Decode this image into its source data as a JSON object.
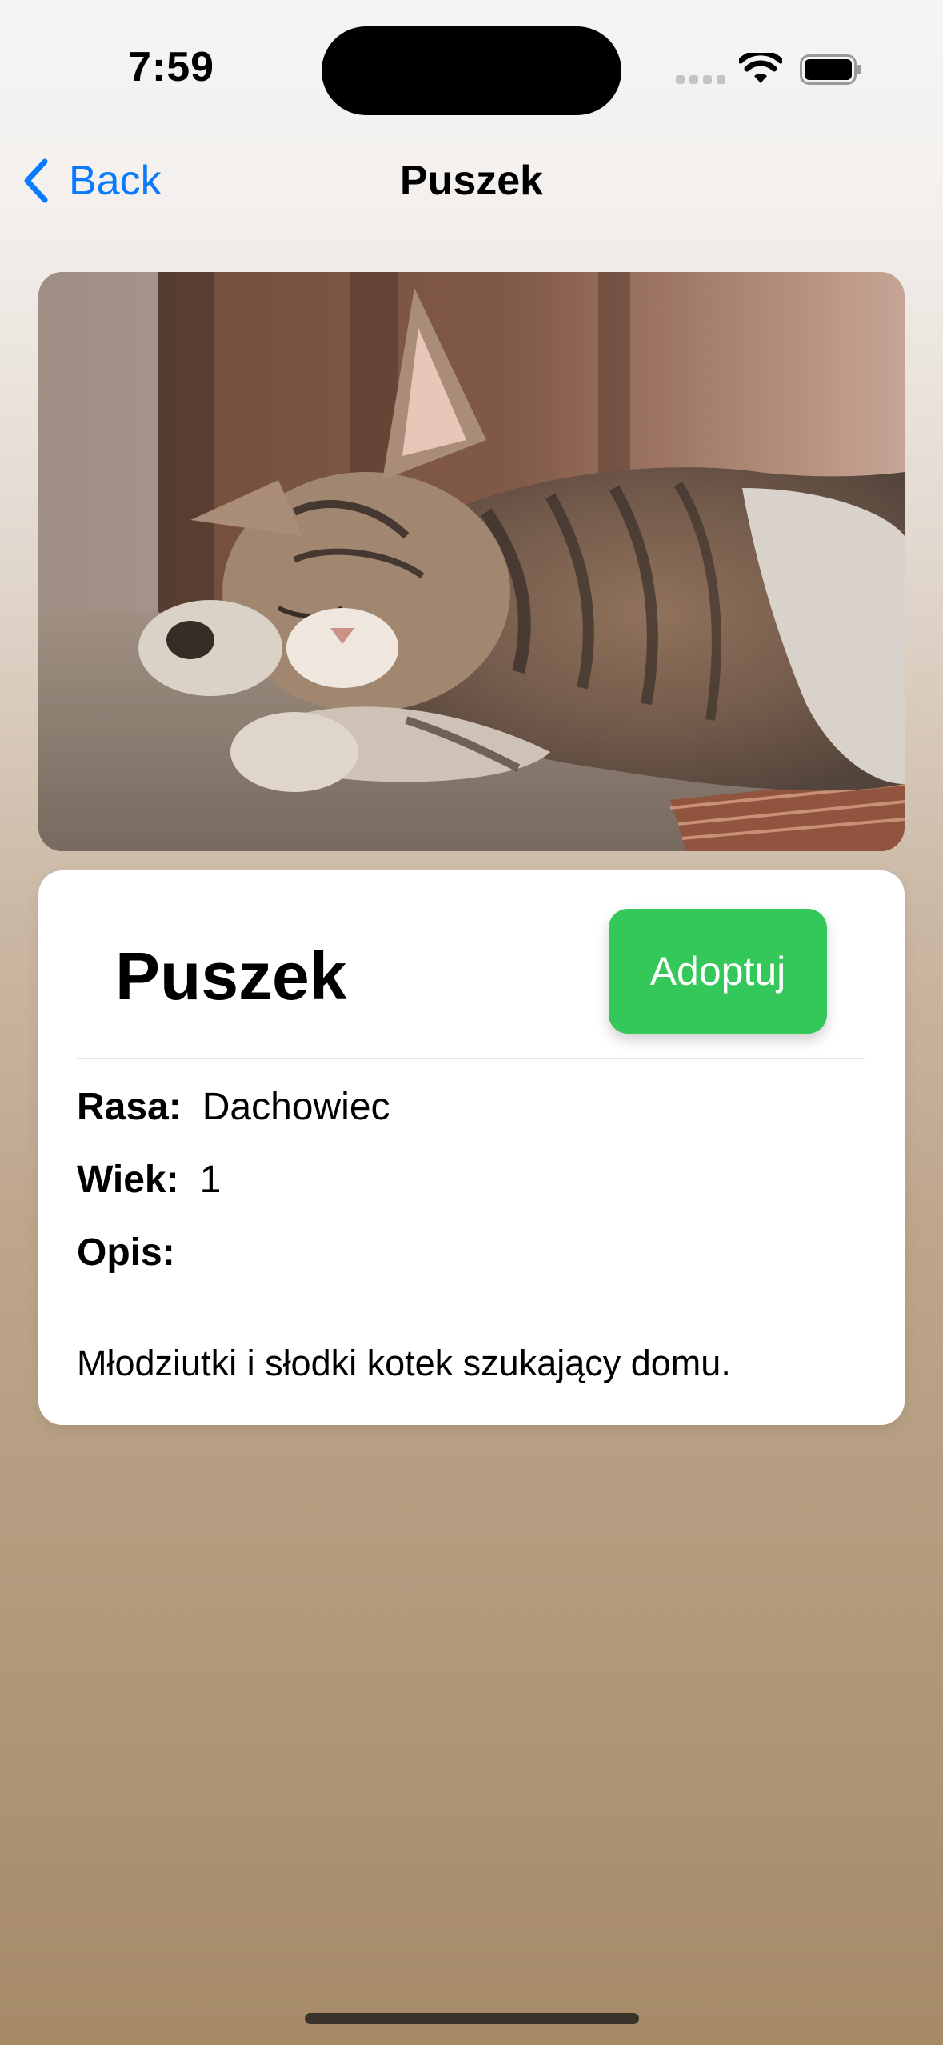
{
  "status_bar": {
    "time": "7:59"
  },
  "nav": {
    "back_label": "Back",
    "title": "Puszek",
    "accent_color": "#0A7AFF"
  },
  "photo": {
    "subject": "sleeping tabby kitten"
  },
  "card": {
    "name": "Puszek",
    "adopt_label": "Adoptuj",
    "adopt_color": "#34C759",
    "breed_label": "Rasa:",
    "breed_value": "Dachowiec",
    "age_label": "Wiek:",
    "age_value": "1",
    "description_label": "Opis:",
    "description": "Młodziutki i słodki kotek szukający domu."
  }
}
